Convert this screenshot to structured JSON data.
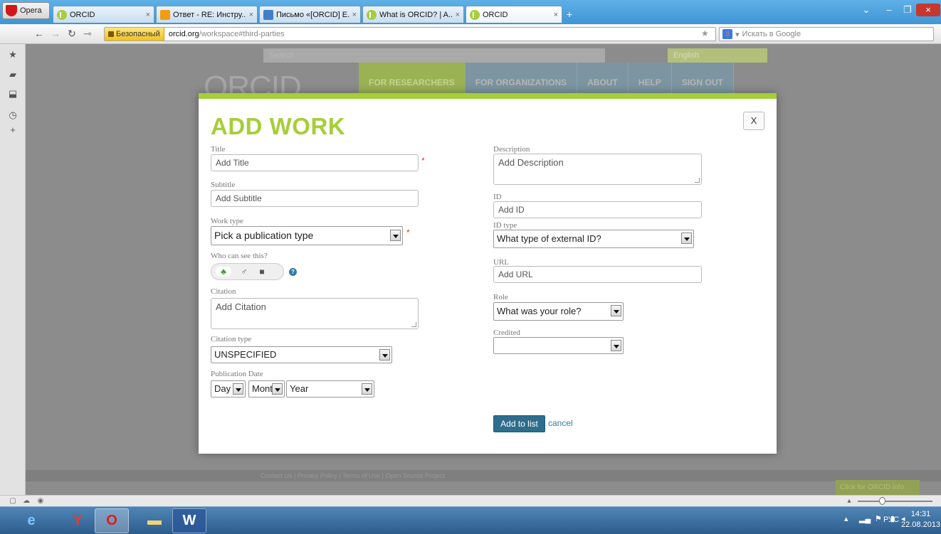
{
  "browser": {
    "opera_label": "Opera",
    "tabs": [
      {
        "title": "ORCID",
        "close": "×",
        "icon": "orcid-icon"
      },
      {
        "title": "Ответ - RE: Инстру...",
        "close": "×",
        "icon": "answer-icon"
      },
      {
        "title": "Письмо «[ORCID] E...",
        "close": "×",
        "icon": "mail-icon"
      },
      {
        "title": "What is ORCID? | A...",
        "close": "×",
        "icon": "orcid-icon"
      },
      {
        "title": "ORCID",
        "close": "×",
        "icon": "orcid-icon"
      }
    ],
    "new_tab": "+",
    "secure_label": "Безопасный",
    "url_host": "orcid.org",
    "url_path": "/workspace#third-parties",
    "search_placeholder": "Искать в Google",
    "search_engine": "8"
  },
  "background_page": {
    "search_placeholder": "Search",
    "language": "English",
    "logo": "ORCID",
    "nav": [
      "FOR RESEARCHERS",
      "FOR ORGANIZATIONS",
      "ABOUT",
      "HELP",
      "SIGN OUT"
    ],
    "footer": "Contact Us | Privacy Policy | Terms of Use | Open Source Project",
    "refer_button": "Click for ORCID info"
  },
  "modal": {
    "title": "ADD WORK",
    "close_label": "X",
    "required_mark": "*",
    "fields": {
      "title": {
        "label": "Title",
        "placeholder": "Add Title"
      },
      "subtitle": {
        "label": "Subtitle",
        "placeholder": "Add Subtitle"
      },
      "work_type": {
        "label": "Work type",
        "value": "Pick a publication type"
      },
      "visibility": {
        "label": "Who can see this?",
        "help": "?"
      },
      "citation": {
        "label": "Citation",
        "placeholder": "Add Citation"
      },
      "citation_type": {
        "label": "Citation type",
        "value": "UNSPECIFIED"
      },
      "publication_date": {
        "label": "Publication Date",
        "day": "Day",
        "month": "Mont",
        "year": "Year"
      },
      "description": {
        "label": "Description",
        "placeholder": "Add Description"
      },
      "id": {
        "label": "ID",
        "placeholder": "Add ID"
      },
      "id_type": {
        "label": "ID type",
        "value": "What type of external ID?"
      },
      "url": {
        "label": "URL",
        "placeholder": "Add URL"
      },
      "role": {
        "label": "Role",
        "value": "What was your role?"
      },
      "credited": {
        "label": "Credited",
        "value": ""
      }
    },
    "add_button": "Add to list",
    "cancel_link": "cancel"
  },
  "taskbar": {
    "language": "РУС",
    "time": "14:31",
    "date": "22.08.2013"
  },
  "colors": {
    "orcid_green": "#a6ce39",
    "button_blue": "#2e6d8c",
    "link_blue": "#2e7ba8",
    "required_red": "#d0392b"
  }
}
